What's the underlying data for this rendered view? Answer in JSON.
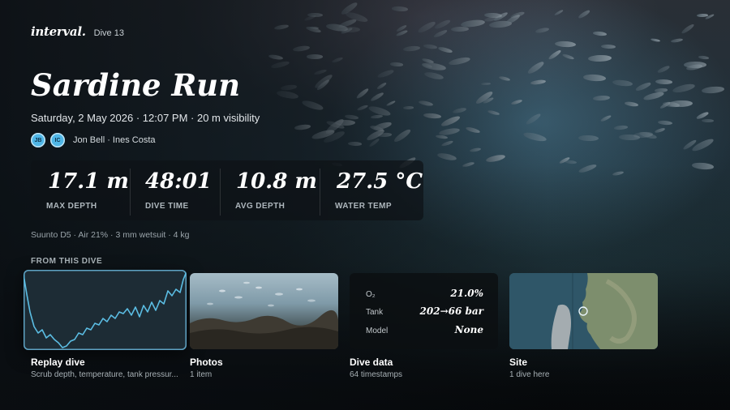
{
  "app": {
    "brand": "interval.",
    "dive_label": "Dive 13"
  },
  "dive": {
    "title": "Sardine Run",
    "subtitle": "Saturday, 2 May 2026 · 12:07 PM · 20 m visibility",
    "buddies": {
      "avatars": [
        {
          "initials": "JB"
        },
        {
          "initials": "IC"
        }
      ],
      "names": "Jon Bell · Ines Costa"
    },
    "stats": [
      {
        "value": "17.1 m",
        "label": "MAX DEPTH"
      },
      {
        "value": "48:01",
        "label": "DIVE TIME"
      },
      {
        "value": "10.8 m",
        "label": "AVG DEPTH"
      },
      {
        "value": "27.5 °C",
        "label": "WATER TEMP"
      }
    ],
    "gear": "Suunto D5 · Air 21% · 3 mm wetsuit · 4 kg"
  },
  "section_title": "FROM THIS DIVE",
  "cards": {
    "replay": {
      "title": "Replay dive",
      "subtitle": "Scrub depth, temperature, tank pressur..."
    },
    "photos": {
      "title": "Photos",
      "subtitle": "1 item"
    },
    "data": {
      "title": "Dive data",
      "subtitle": "64 timestamps",
      "rows": [
        {
          "label": "O₂",
          "value": "21.0%"
        },
        {
          "label": "Tank",
          "value": "202→66 bar"
        },
        {
          "label": "Model",
          "value": "None"
        }
      ]
    },
    "site": {
      "title": "Site",
      "subtitle": "1 dive here"
    }
  },
  "colors": {
    "accent": "#4fb6e6",
    "depth_line": "#5bbde3"
  }
}
